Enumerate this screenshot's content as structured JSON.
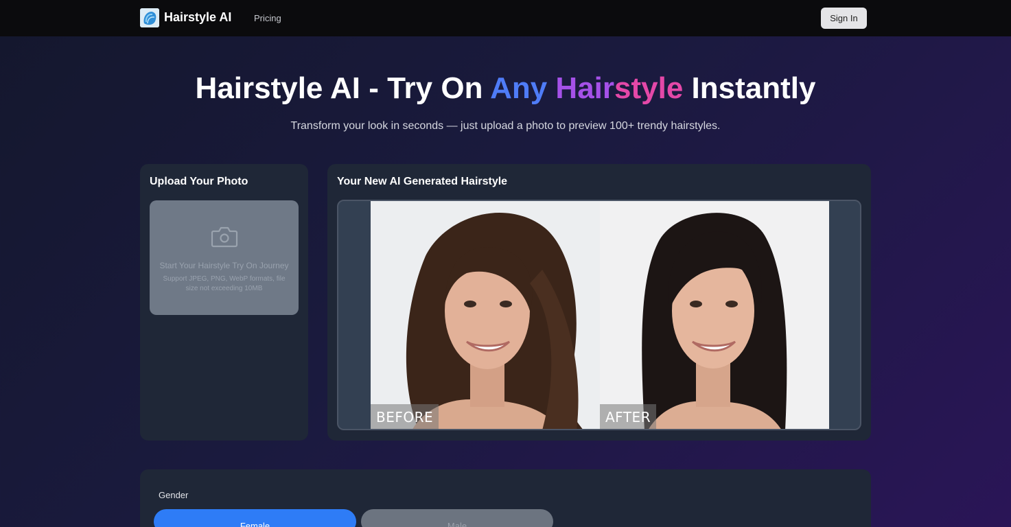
{
  "header": {
    "brand": "Hairstyle AI",
    "nav_pricing": "Pricing",
    "signin_label": "Sign In"
  },
  "hero": {
    "title_part1": "Hairstyle AI - Try On ",
    "title_any": "Any",
    "title_hair": " Hair",
    "title_style": "style",
    "title_part2": " Instantly",
    "subtitle": "Transform your look in seconds — just upload a photo to preview 100+ trendy hairstyles."
  },
  "upload": {
    "title": "Upload Your Photo",
    "dropzone_title": "Start Your Hairstyle Try On Journey",
    "dropzone_hint": "Support JPEG, PNG, WebP formats, file size not exceeding 10MB",
    "icon": "camera-icon"
  },
  "result": {
    "title": "Your New AI Generated Hairstyle",
    "before_label": "BEFORE",
    "after_label": "AFTER"
  },
  "options": {
    "gender_label": "Gender",
    "female_label": "Female",
    "male_label": "Male",
    "selected": "Female"
  },
  "colors": {
    "accent_blue": "#2e7cf6",
    "gradient_blue": "#4f7cf7",
    "gradient_purple": "#a551e8",
    "gradient_pink": "#e448a8"
  }
}
